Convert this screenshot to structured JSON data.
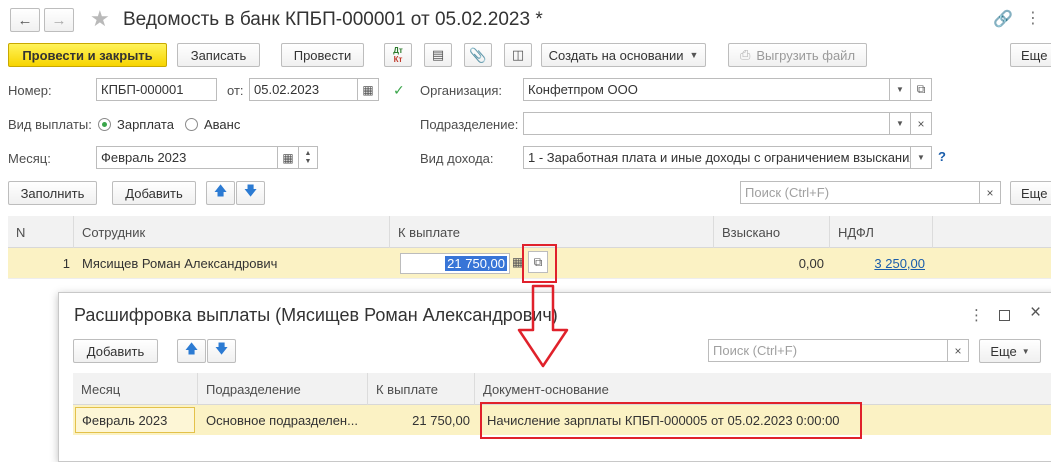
{
  "window": {
    "title": "Ведомость в банк КПБП-000001 от 05.02.2023 *"
  },
  "toolbar": {
    "post_and_close": "Провести и закрыть",
    "write": "Записать",
    "post": "Провести",
    "dt_kt_top": "Дт",
    "dt_kt_bottom": "Кт",
    "create_based_on": "Создать на основании",
    "export_file": "Выгрузить файл",
    "more": "Еще"
  },
  "form": {
    "number_label": "Номер:",
    "number_value": "КПБП-000001",
    "from_label": "от:",
    "date_value": "05.02.2023",
    "org_label": "Организация:",
    "org_value": "Конфетпром ООО",
    "payout_type_label": "Вид выплаты:",
    "payout_salary": "Зарплата",
    "payout_advance": "Аванс",
    "division_label": "Подразделение:",
    "division_value": "",
    "month_label": "Месяц:",
    "month_value": "Февраль 2023",
    "income_type_label": "Вид дохода:",
    "income_type_value": "1 - Заработная плата и иные доходы с ограничением взыскания",
    "help": "?"
  },
  "table_toolbar": {
    "fill": "Заполнить",
    "add": "Добавить",
    "search_placeholder": "Поиск (Ctrl+F)",
    "more": "Еще"
  },
  "table": {
    "columns": [
      "N",
      "Сотрудник",
      "К выплате",
      "Взыскано",
      "НДФЛ"
    ],
    "rows": [
      {
        "n": "1",
        "employee": "Мясищев Роман Александрович",
        "to_pay": "21 750,00",
        "withheld": "0,00",
        "ndfl": "3 250,00"
      }
    ]
  },
  "popup": {
    "title": "Расшифровка выплаты (Мясищев Роман Александрович)",
    "add": "Добавить",
    "search_placeholder": "Поиск (Ctrl+F)",
    "more": "Еще",
    "columns": [
      "Месяц",
      "Подразделение",
      "К выплате",
      "Документ-основание"
    ],
    "rows": [
      {
        "month": "Февраль 2023",
        "division": "Основное подразделен...",
        "to_pay": "21 750,00",
        "document": "Начисление зарплаты КПБП-000005 от 05.02.2023 0:00:00"
      }
    ]
  },
  "colors": {
    "highlight_row": "#fbf2c4",
    "accent_yellow": "#f7d400",
    "annotation_red": "#e0212b",
    "link": "#1a5dab"
  }
}
